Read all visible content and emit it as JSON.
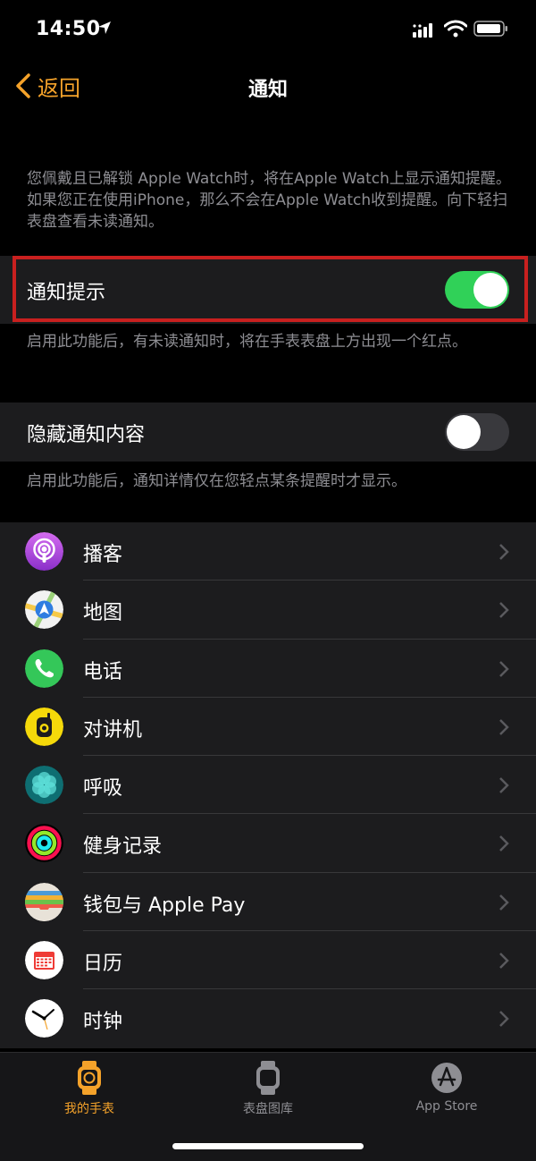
{
  "status": {
    "time": "14:50"
  },
  "nav": {
    "back_label": "返回",
    "title": "通知"
  },
  "intro_text": "您佩戴且已解锁 Apple Watch时，将在Apple Watch上显示通知提醒。如果您正在使用iPhone，那么不会在Apple Watch收到提醒。向下轻扫表盘查看未读通知。",
  "notification_indicator": {
    "label": "通知提示",
    "on": true,
    "footer": "启用此功能后，有未读通知时，将在手表表盘上方出现一个红点。"
  },
  "hide_content": {
    "label": "隐藏通知内容",
    "on": false,
    "footer": "启用此功能后，通知详情仅在您轻点某条提醒时才显示。"
  },
  "apps": [
    {
      "name": "播客",
      "icon": "podcasts-icon"
    },
    {
      "name": "地图",
      "icon": "maps-icon"
    },
    {
      "name": "电话",
      "icon": "phone-icon"
    },
    {
      "name": "对讲机",
      "icon": "walkie-talkie-icon"
    },
    {
      "name": "呼吸",
      "icon": "breathe-icon"
    },
    {
      "name": "健身记录",
      "icon": "activity-icon"
    },
    {
      "name": "钱包与 Apple Pay",
      "icon": "wallet-icon"
    },
    {
      "name": "日历",
      "icon": "calendar-icon"
    },
    {
      "name": "时钟",
      "icon": "clock-icon"
    }
  ],
  "tabs": [
    {
      "label": "我的手表",
      "active": true
    },
    {
      "label": "表盘图库",
      "active": false
    },
    {
      "label": "App Store",
      "active": false
    }
  ],
  "colors": {
    "accent": "#f4a22a",
    "toggle_on": "#30d158",
    "highlight": "#c8201f"
  }
}
